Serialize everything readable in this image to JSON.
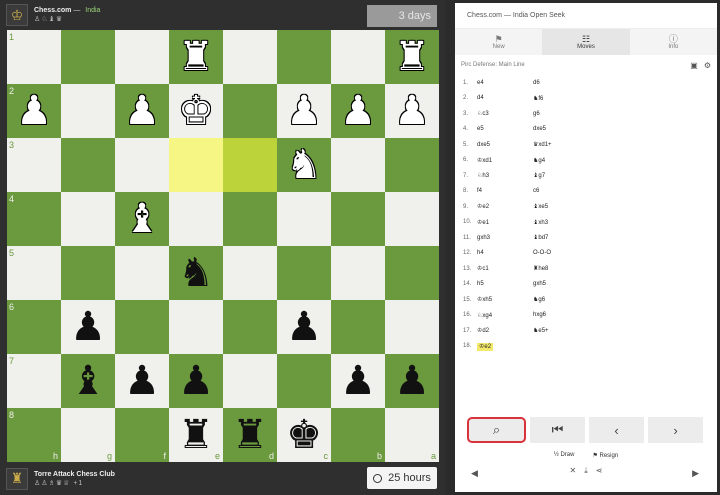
{
  "top_player": {
    "name": "Chess.com",
    "separator": "—",
    "country": "India",
    "captured": "♙♘♝♛",
    "timer": "3 days"
  },
  "bottom_player": {
    "name": "Torre Attack Chess Club",
    "captured": "♙♙♗♛♕",
    "score": "+1",
    "timer": "25 hours"
  },
  "board": {
    "ranks": [
      "1",
      "2",
      "3",
      "4",
      "5",
      "6",
      "7",
      "8"
    ],
    "files": [
      "h",
      "g",
      "f",
      "e",
      "d",
      "c",
      "b",
      "a"
    ],
    "rows": [
      [
        "",
        "",
        "",
        "♜w",
        "",
        "",
        "",
        "♜w"
      ],
      [
        "♟w",
        "",
        "♟w",
        "♚w",
        "",
        "♟w",
        "♟w",
        "♟w"
      ],
      [
        "",
        "",
        "",
        "",
        "",
        "♞w",
        "",
        ""
      ],
      [
        "",
        "",
        "♝w",
        "",
        "",
        "",
        "",
        ""
      ],
      [
        "",
        "",
        "",
        "♞b",
        "",
        "",
        "",
        ""
      ],
      [
        "",
        "♟b",
        "",
        "",
        "",
        "♟b",
        "",
        ""
      ],
      [
        "",
        "♝b",
        "♟b",
        "♟b",
        "",
        "",
        "♟b",
        "♟b"
      ],
      [
        "",
        "",
        "",
        "♜b",
        "♜b",
        "♚b",
        "",
        ""
      ]
    ],
    "highlight": [
      "2-3",
      "2-4"
    ]
  },
  "panel": {
    "title": "Chess.com — India Open Seek",
    "tabs": [
      {
        "icon": "⚑",
        "label": "New"
      },
      {
        "icon": "☷",
        "label": "Moves"
      },
      {
        "icon": "ⓘ",
        "label": "Info"
      }
    ],
    "opening": "Pirc Defense: Main Line",
    "moves": [
      {
        "n": "1.",
        "w": "e4",
        "b": "d6"
      },
      {
        "n": "2.",
        "w": "d4",
        "b": "♞f6"
      },
      {
        "n": "3.",
        "w": "♘c3",
        "b": "g6"
      },
      {
        "n": "4.",
        "w": "e5",
        "b": "dxe5"
      },
      {
        "n": "5.",
        "w": "dxe5",
        "b": "♛xd1+"
      },
      {
        "n": "6.",
        "w": "♔xd1",
        "b": "♞g4"
      },
      {
        "n": "7.",
        "w": "♘h3",
        "b": "♝g7"
      },
      {
        "n": "8.",
        "w": "f4",
        "b": "c6"
      },
      {
        "n": "9.",
        "w": "♔e2",
        "b": "♝xe5"
      },
      {
        "n": "10.",
        "w": "♔e1",
        "b": "♝xh3"
      },
      {
        "n": "11.",
        "w": "gxh3",
        "b": "♝bd7"
      },
      {
        "n": "12.",
        "w": "h4",
        "b": "O-O-O"
      },
      {
        "n": "13.",
        "w": "♔c1",
        "b": "♜he8"
      },
      {
        "n": "14.",
        "w": "h5",
        "b": "gxh5"
      },
      {
        "n": "15.",
        "w": "♔xh5",
        "b": "♞g6"
      },
      {
        "n": "16.",
        "w": "♘xg4",
        "b": "hxg6"
      },
      {
        "n": "17.",
        "w": "♔d2",
        "b": "♞e5+"
      },
      {
        "n": "18.",
        "w": "♔e2",
        "b": ""
      }
    ],
    "actions": {
      "draw": "Draw",
      "resign": "Resign"
    }
  }
}
